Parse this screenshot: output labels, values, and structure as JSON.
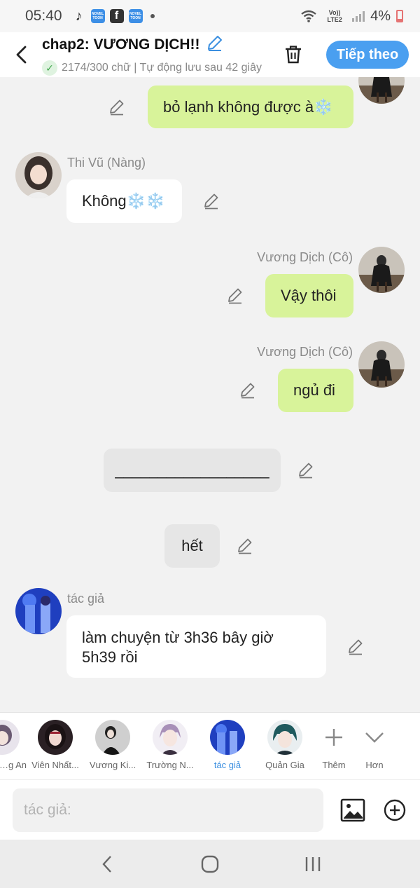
{
  "status_bar": {
    "time": "05:40",
    "app_icons": [
      "tiktok-icon",
      "novel-toon-icon",
      "facebook-icon",
      "novel-toon-icon"
    ],
    "novel_badge": "NOVEL TOON",
    "network": "Vo)) LTE2",
    "battery": "4%"
  },
  "header": {
    "title": "chap2: VƯƠNG DỊCH!!",
    "subtitle": "2174/300 chữ | Tự động lưu sau 42 giây",
    "next_label": "Tiếp theo"
  },
  "messages": [
    {
      "side": "right",
      "name": "",
      "text": "bỏ lạnh không được à",
      "emoji": "❄️"
    },
    {
      "side": "left",
      "name": "Thi Vũ (Nàng)",
      "text": "Không",
      "emoji": "❄️❄️"
    },
    {
      "side": "right",
      "name": "Vương Dịch (Cô)",
      "text": "Vậy thôi"
    },
    {
      "side": "right",
      "name": "Vương Dịch (Cô)",
      "text": "ngủ đi"
    },
    {
      "side": "center",
      "text": "__________________"
    },
    {
      "side": "center",
      "text": "hết"
    },
    {
      "side": "left",
      "name": "tác giả",
      "text": "làm chuyện từ 3h36 bây giờ 5h39 rồi"
    }
  ],
  "characters": [
    {
      "label": "Thi Vũ (Nàng An..."
    },
    {
      "label": "Viên Nhất..."
    },
    {
      "label": "Vương Ki..."
    },
    {
      "label": "Trường N..."
    },
    {
      "label": "tác giả",
      "active": true
    },
    {
      "label": "Quản Gia"
    }
  ],
  "tools": {
    "add_label": "Thêm",
    "more_label": "Hơn"
  },
  "composer": {
    "placeholder": "tác giả:"
  },
  "colors": {
    "accent": "#4a9ff0",
    "bubble_green": "#d8f39a",
    "active_label": "#3b8fe0"
  }
}
